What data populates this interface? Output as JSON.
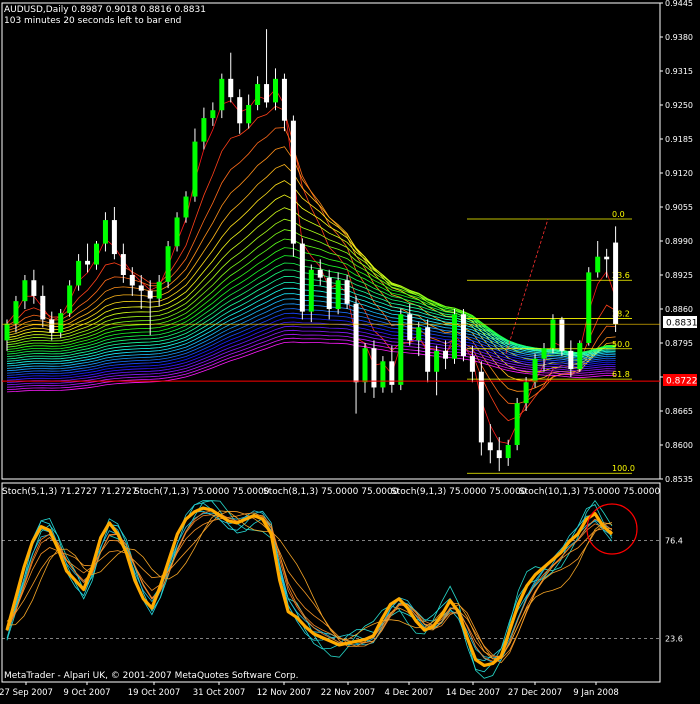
{
  "window": {
    "header_line1": "AUDUSD,Daily  0.8987 0.9018 0.8816 0.8831",
    "header_line2": "103 minutes 20 seconds left to bar end",
    "footer": "MetaTrader - Alpari UK, © 2001-2007 MetaQuotes Software Corp."
  },
  "colors": {
    "background": "#000000",
    "bull_candle": "#00ff00",
    "bear_candle": "#ffffff",
    "fib_line": "#ffff00",
    "red_level": "#ff0000",
    "price_tag": "#ffffff",
    "red_tag": "#ff0000",
    "circle": "#ff0000"
  },
  "chart_data": [
    {
      "type": "candlestick",
      "symbol": "AUDUSD",
      "timeframe": "Daily",
      "ohlc_last": {
        "open": 0.8987,
        "high": 0.9018,
        "low": 0.8816,
        "close": 0.8831
      },
      "ylim": [
        0.8535,
        0.9445
      ],
      "y_ticks": [
        "0.9445",
        "0.9380",
        "0.9315",
        "0.9250",
        "0.9185",
        "0.9120",
        "0.9055",
        "0.8990",
        "0.8925",
        "0.8860",
        "0.8795",
        "0.8730",
        "0.8665",
        "0.8600",
        "0.8535"
      ],
      "x_ticks": [
        "27 Sep 2007",
        "9 Oct 2007",
        "19 Oct 2007",
        "31 Oct 2007",
        "12 Nov 2007",
        "22 Nov 2007",
        "4 Dec 2007",
        "14 Dec 2007",
        "27 Dec 2007",
        "9 Jan 2008"
      ],
      "current_price_label": "0.8831",
      "red_level_label": "0.8722",
      "red_level_value": 0.8722,
      "fibonacci": {
        "levels": [
          {
            "label": "0.0",
            "value": 0.9032
          },
          {
            "label": "23.6",
            "value": 0.8915
          },
          {
            "label": "38.2",
            "value": 0.8842
          },
          {
            "label": "50.0",
            "value": 0.8784
          },
          {
            "label": "61.8",
            "value": 0.8726
          },
          {
            "label": "100.0",
            "value": 0.8546
          }
        ]
      },
      "candles": [
        [
          0.88,
          0.884,
          0.878,
          0.8832
        ],
        [
          0.8832,
          0.8885,
          0.8815,
          0.8875
        ],
        [
          0.8875,
          0.8925,
          0.886,
          0.8915
        ],
        [
          0.8915,
          0.8935,
          0.887,
          0.8885
        ],
        [
          0.8885,
          0.8905,
          0.8825,
          0.884
        ],
        [
          0.884,
          0.8855,
          0.88,
          0.8815
        ],
        [
          0.8815,
          0.886,
          0.8805,
          0.8852
        ],
        [
          0.8852,
          0.8915,
          0.8845,
          0.8905
        ],
        [
          0.8905,
          0.8965,
          0.8895,
          0.8952
        ],
        [
          0.8952,
          0.8985,
          0.893,
          0.8945
        ],
        [
          0.8945,
          0.899,
          0.8935,
          0.8985
        ],
        [
          0.8985,
          0.9045,
          0.897,
          0.903
        ],
        [
          0.903,
          0.9055,
          0.8955,
          0.8965
        ],
        [
          0.8965,
          0.8985,
          0.891,
          0.8925
        ],
        [
          0.8925,
          0.894,
          0.8885,
          0.8905
        ],
        [
          0.8905,
          0.8925,
          0.886,
          0.8895
        ],
        [
          0.8895,
          0.8915,
          0.881,
          0.888
        ],
        [
          0.888,
          0.8925,
          0.8865,
          0.8912
        ],
        [
          0.8912,
          0.899,
          0.89,
          0.898
        ],
        [
          0.898,
          0.9045,
          0.897,
          0.9035
        ],
        [
          0.9035,
          0.9085,
          0.9025,
          0.9075
        ],
        [
          0.9075,
          0.9205,
          0.9065,
          0.918
        ],
        [
          0.918,
          0.9245,
          0.9165,
          0.9225
        ],
        [
          0.9225,
          0.9255,
          0.921,
          0.924
        ],
        [
          0.924,
          0.931,
          0.9225,
          0.93
        ],
        [
          0.93,
          0.935,
          0.9255,
          0.9265
        ],
        [
          0.9265,
          0.928,
          0.9195,
          0.9215
        ],
        [
          0.9215,
          0.927,
          0.9205,
          0.925
        ],
        [
          0.925,
          0.9305,
          0.924,
          0.929
        ],
        [
          0.929,
          0.9395,
          0.9245,
          0.9255
        ],
        [
          0.9255,
          0.932,
          0.924,
          0.93
        ],
        [
          0.93,
          0.931,
          0.92,
          0.922
        ],
        [
          0.922,
          0.923,
          0.896,
          0.8985
        ],
        [
          0.8985,
          0.8995,
          0.884,
          0.8855
        ],
        [
          0.8855,
          0.8945,
          0.8835,
          0.8935
        ],
        [
          0.8935,
          0.8955,
          0.8905,
          0.892
        ],
        [
          0.892,
          0.8935,
          0.884,
          0.886
        ],
        [
          0.886,
          0.893,
          0.885,
          0.8915
        ],
        [
          0.8915,
          0.8925,
          0.886,
          0.887
        ],
        [
          0.887,
          0.8885,
          0.866,
          0.872
        ],
        [
          0.872,
          0.8795,
          0.87,
          0.8785
        ],
        [
          0.8785,
          0.88,
          0.869,
          0.871
        ],
        [
          0.871,
          0.877,
          0.87,
          0.876
        ],
        [
          0.876,
          0.879,
          0.87,
          0.8715
        ],
        [
          0.8715,
          0.886,
          0.8705,
          0.885
        ],
        [
          0.885,
          0.887,
          0.879,
          0.88
        ],
        [
          0.88,
          0.8835,
          0.877,
          0.8825
        ],
        [
          0.8825,
          0.884,
          0.872,
          0.874
        ],
        [
          0.874,
          0.879,
          0.8695,
          0.878
        ],
        [
          0.878,
          0.88,
          0.8745,
          0.8765
        ],
        [
          0.8765,
          0.886,
          0.8755,
          0.885
        ],
        [
          0.885,
          0.886,
          0.876,
          0.877
        ],
        [
          0.877,
          0.879,
          0.872,
          0.874
        ],
        [
          0.874,
          0.876,
          0.858,
          0.8605
        ],
        [
          0.8605,
          0.864,
          0.8565,
          0.859
        ],
        [
          0.859,
          0.8615,
          0.855,
          0.8575
        ],
        [
          0.8575,
          0.861,
          0.856,
          0.86
        ],
        [
          0.86,
          0.869,
          0.859,
          0.868
        ],
        [
          0.868,
          0.873,
          0.8665,
          0.872
        ],
        [
          0.872,
          0.8775,
          0.871,
          0.8765
        ],
        [
          0.8765,
          0.8795,
          0.874,
          0.8785
        ],
        [
          0.8785,
          0.885,
          0.8775,
          0.884
        ],
        [
          0.884,
          0.8845,
          0.877,
          0.878
        ],
        [
          0.878,
          0.88,
          0.873,
          0.8745
        ],
        [
          0.8745,
          0.88,
          0.874,
          0.8795
        ],
        [
          0.8795,
          0.894,
          0.879,
          0.893
        ],
        [
          0.893,
          0.899,
          0.892,
          0.896
        ],
        [
          0.896,
          0.8975,
          0.892,
          0.8955
        ],
        [
          0.8987,
          0.9018,
          0.8816,
          0.8831
        ]
      ]
    },
    {
      "type": "line",
      "indicator": "Stochastic",
      "header_labels": [
        "Stoch(5,1,3) 71.2727 71.2727",
        "Stoch(7,1,3) 75.0000 75.0000",
        "Stoch(8,1,3) 75.0000 75.0000",
        "Stoch(9,1,3) 75.0000 75.0000",
        "Stoch(10,1,3) 75.0000 75.0000"
      ],
      "ylim": [
        0,
        100
      ],
      "levels": [
        {
          "label": "76.4",
          "value": 76.4
        },
        {
          "label": "23.6",
          "value": 23.6
        }
      ],
      "main_series": [
        28,
        45,
        62,
        76,
        84,
        82,
        72,
        60,
        55,
        50,
        62,
        78,
        86,
        80,
        70,
        55,
        45,
        40,
        52,
        66,
        80,
        88,
        92,
        94,
        93,
        90,
        87,
        86,
        88,
        90,
        88,
        80,
        55,
        38,
        35,
        30,
        26,
        24,
        22,
        20,
        21,
        22,
        23,
        25,
        34,
        42,
        45,
        40,
        33,
        28,
        30,
        36,
        44,
        38,
        24,
        12,
        9,
        10,
        14,
        28,
        42,
        52,
        58,
        62,
        66,
        70,
        76,
        80,
        88,
        91,
        84,
        80
      ]
    }
  ]
}
